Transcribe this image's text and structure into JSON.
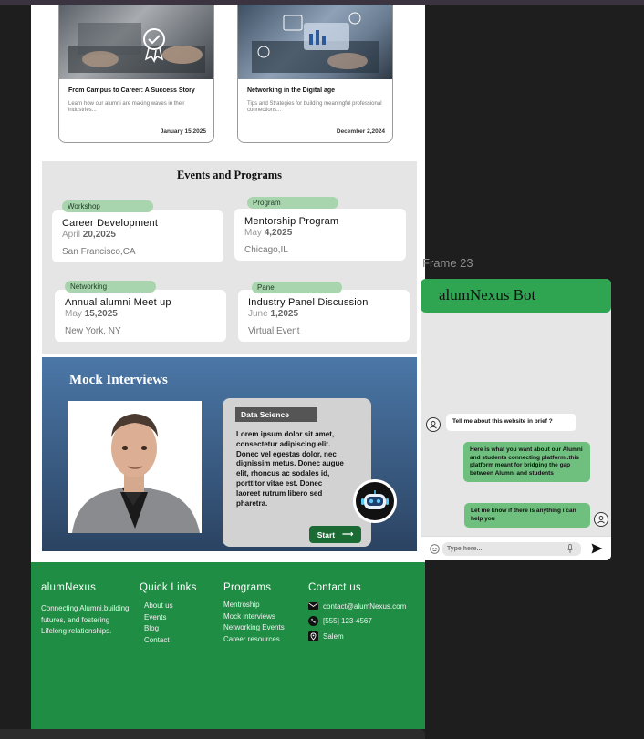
{
  "blog": [
    {
      "title": "From Campus to Career: A Success Story",
      "desc": "Learn how our alumni are making waves in their industries...",
      "date": "January 15,2025"
    },
    {
      "title": "Networking in the Digital age",
      "desc": "Tips and Strategies for building meaningful professional connections...",
      "date": "December 2,2024"
    }
  ],
  "events": {
    "heading": "Events and Programs",
    "items": [
      {
        "tag": "Workshop",
        "title": "Career Development",
        "month": "April",
        "day": "20,2025",
        "location": "San Francisco,CA"
      },
      {
        "tag": "Program",
        "title": "Mentorship Program",
        "month": "May",
        "day": "4,2025",
        "location": "Chicago,IL"
      },
      {
        "tag": "Networking",
        "title": "Annual alumni Meet up",
        "month": "May",
        "day": "15,2025",
        "location": "New York, NY"
      },
      {
        "tag": "Panel",
        "title": "Industry Panel Discussion",
        "month": "June",
        "day": "1,2025",
        "location": "Virtual Event"
      }
    ]
  },
  "mock": {
    "heading": "Mock Interviews",
    "card_label": "Data Science",
    "card_text": "Lorem ipsum dolor sit amet, consectetur adipiscing elit. Donec vel egestas dolor, nec dignissim metus. Donec augue elit, rhoncus ac sodales id, porttitor vitae est. Donec laoreet rutrum libero sed pharetra.",
    "start_label": "Start"
  },
  "footer": {
    "brand": "alumNexus",
    "brand_text": "Connecting Alumni,building futures, and fostering Lifelong relationships.",
    "quick_links_title": "Quick Links",
    "quick_links": [
      "About us",
      "Events",
      "Blog",
      "Contact"
    ],
    "programs_title": "Programs",
    "programs": [
      "Mentroship",
      "Mock interviews",
      "Networking Events",
      "Career resources"
    ],
    "contact_title": "Contact us",
    "email": "contact@alumNexus.com",
    "phone": "[555] 123-4567",
    "location": "Salem"
  },
  "frame_label": "Frame 23",
  "chat": {
    "title": "alumNexus Bot",
    "messages": [
      {
        "from": "user",
        "text": "Tell me about this website in brief ?"
      },
      {
        "from": "bot",
        "text": "Here is what you want about our Alumni and students connecting platform..this platform meant for bridging the gap between Alumni and students"
      },
      {
        "from": "bot",
        "text": "Let me know if there is anything i can help you"
      }
    ],
    "input_placeholder": "Type here..."
  },
  "colors": {
    "footer_green": "#1f8e44",
    "bot_header_green": "#2fa552",
    "bot_bubble_green": "#6fc07e",
    "tag_green": "#a8d5ae",
    "mock_blue": "#4b77a7"
  }
}
